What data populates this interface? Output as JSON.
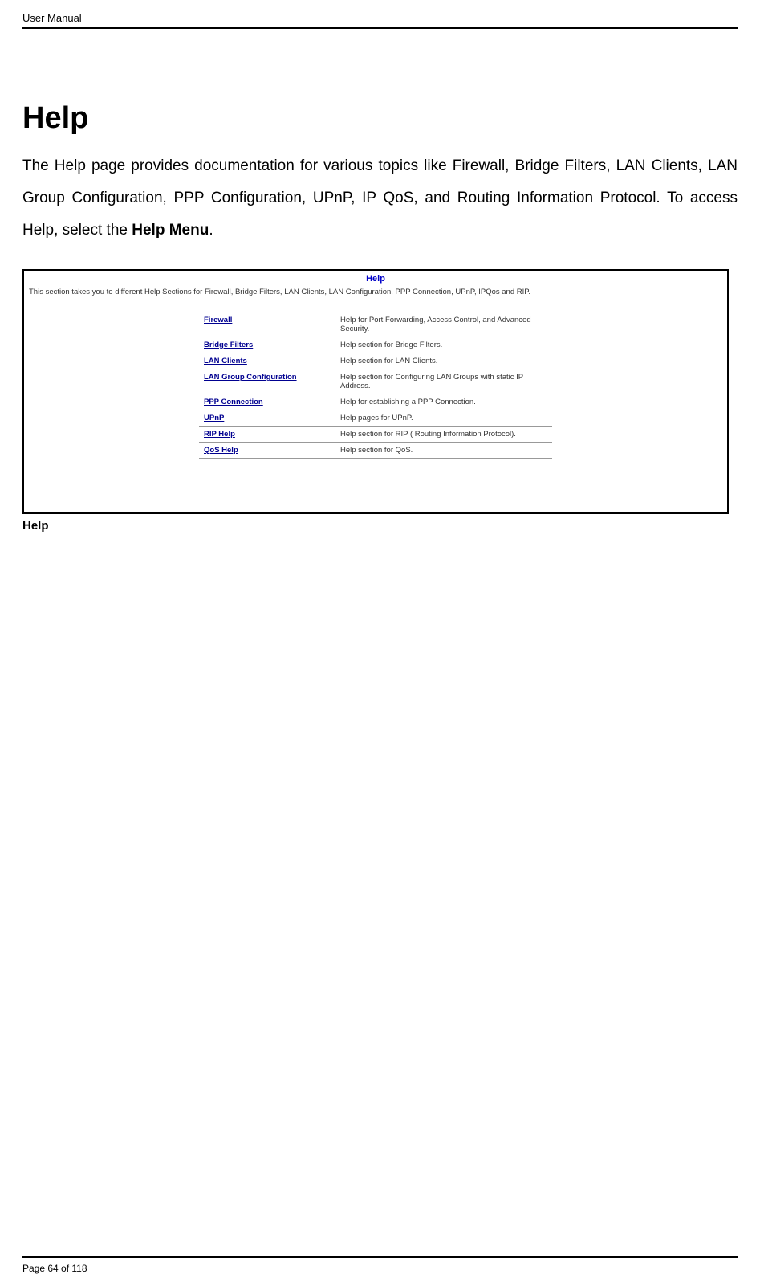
{
  "header": {
    "doc_title": "User Manual"
  },
  "page": {
    "heading": "Help",
    "intro_pre": "The Help page provides documentation for various topics like Firewall, Bridge Filters, LAN Clients, LAN Group Configuration, PPP Configuration, UPnP, IP QoS, and Routing Information Protocol. To access Help, select the ",
    "intro_bold": "Help Menu",
    "intro_post": "."
  },
  "screenshot": {
    "title": "Help",
    "subtitle": "This section takes you to different Help Sections for Firewall, Bridge Filters, LAN Clients, LAN Configuration, PPP Connection, UPnP, IPQos and RIP.",
    "rows": [
      {
        "link": "Firewall",
        "desc": "Help for Port Forwarding, Access Control, and Advanced Security."
      },
      {
        "link": "Bridge Filters",
        "desc": "Help section for Bridge Filters."
      },
      {
        "link": "LAN Clients",
        "desc": "Help section for LAN Clients."
      },
      {
        "link": "LAN Group Configuration",
        "desc": "Help section for Configuring LAN Groups with static IP Address."
      },
      {
        "link": "PPP Connection",
        "desc": "Help for establishing a PPP Connection."
      },
      {
        "link": "UPnP",
        "desc": "Help pages for UPnP."
      },
      {
        "link": "RIP Help",
        "desc": "Help section for RIP ( Routing Information Protocol)."
      },
      {
        "link": "QoS Help",
        "desc": "Help section for QoS."
      }
    ],
    "caption": "Help"
  },
  "footer": {
    "page_line": "Page 64 of 118"
  }
}
